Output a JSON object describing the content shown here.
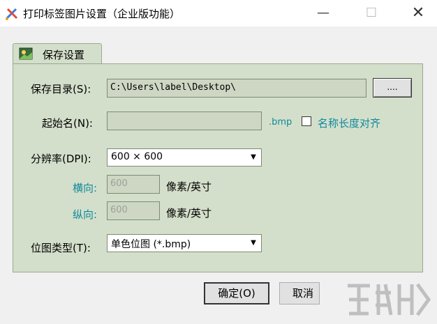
{
  "window": {
    "title": "打印标签图片设置（企业版功能）",
    "minimize_symbol": "—",
    "maximize_symbol": "☐",
    "close_symbol": "✕"
  },
  "tab": {
    "label": "保存设置"
  },
  "save_dir": {
    "label": "保存目录(S):",
    "value": "C:\\Users\\label\\Desktop\\",
    "browse_label": "...."
  },
  "start_name": {
    "label": "起始名(N):",
    "value": "",
    "extension": ".bmp",
    "align_checkbox_label": "名称长度对齐",
    "align_checked": false
  },
  "resolution": {
    "label": "分辨率(DPI):",
    "selected": "600 × 600",
    "horizontal_label": "横向:",
    "horizontal_value": "600",
    "vertical_label": "纵向:",
    "vertical_value": "600",
    "unit": "像素/英寸"
  },
  "bitmap_type": {
    "label": "位图类型(T):",
    "selected": "单色位图 (*.bmp)"
  },
  "buttons": {
    "ok": "确定(O)",
    "cancel": "取消"
  },
  "colors": {
    "panel_bg": "#d4dfcb",
    "muted_label": "#0e8a9c"
  }
}
